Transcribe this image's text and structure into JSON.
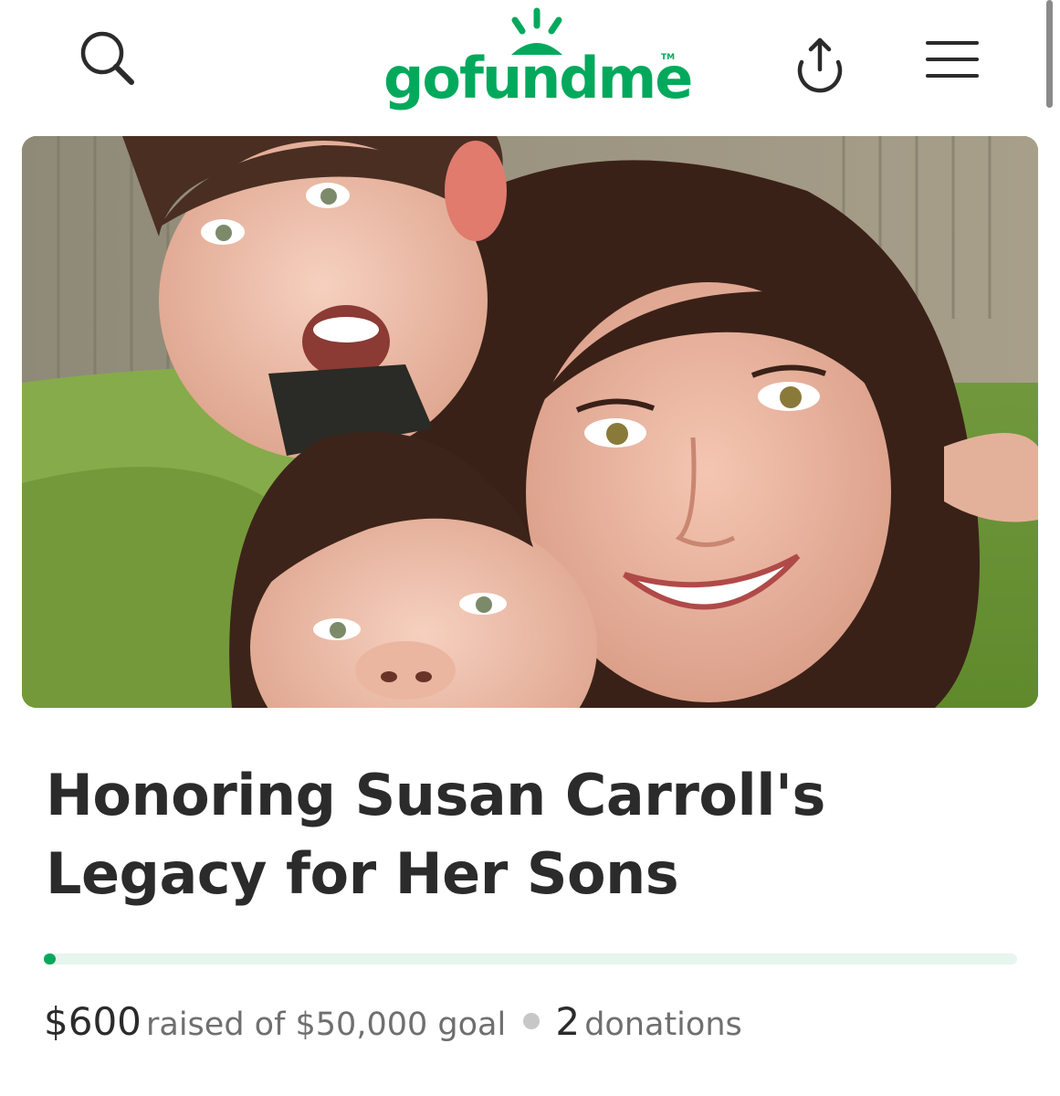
{
  "header": {
    "logo_text": "gofundme",
    "logo_tm": "TM",
    "icons": [
      "search-icon",
      "share-icon",
      "menu-icon"
    ]
  },
  "campaign": {
    "photo_subject": "campaign-photo",
    "title": "Honoring Susan Carroll's Legacy for Her Sons",
    "raised_amount": "$600",
    "raised_label": "raised of $50,000 goal",
    "donations_count": "2",
    "donations_label": "donations",
    "progress_fraction": 0.012
  },
  "colors": {
    "brand_green": "#02a95c",
    "progress_track": "#e6f5ee",
    "title_text": "#2b2b2b",
    "muted_text": "#6f6f6f"
  }
}
